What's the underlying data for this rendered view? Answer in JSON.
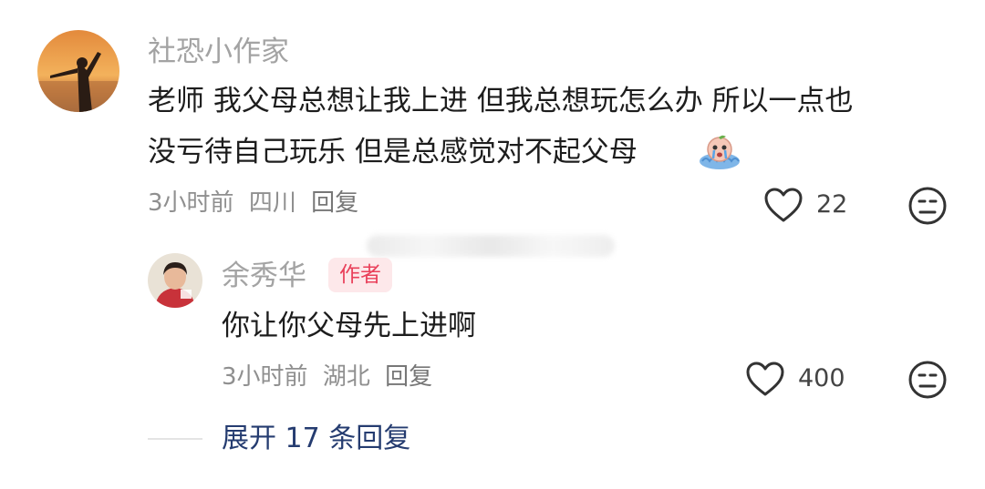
{
  "comment": {
    "username": "社恐小作家",
    "text_line1": "老师 我父母总想让我上进 但我总想玩怎么办 所以一点也",
    "text_line2": "没亏待自己玩乐 但是总感觉对不起父母",
    "emoji_icon": "crying-emoji-icon",
    "time": "3小时前",
    "location": "四川",
    "reply_label": "回复",
    "like_count": "22"
  },
  "reply": {
    "username": "余秀华",
    "badge": "作者",
    "text": "你让你父母先上进啊",
    "time": "3小时前",
    "location": "湖北",
    "reply_label": "回复",
    "like_count": "400"
  },
  "expand": {
    "label": "展开 17 条回复"
  },
  "colors": {
    "badge_bg": "#fde8ea",
    "badge_text": "#e9405a",
    "expand_text": "#253c70"
  }
}
